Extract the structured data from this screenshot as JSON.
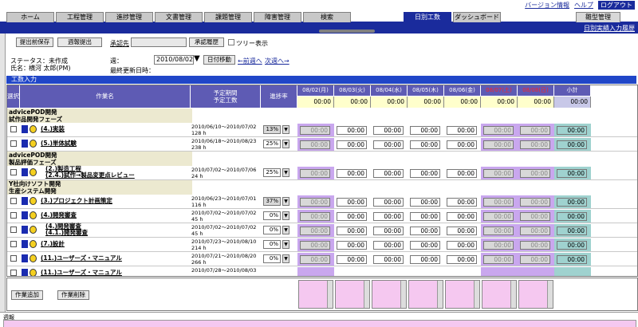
{
  "header": {
    "links": [
      "バージョン情報",
      "ヘルプ",
      "ログアウト"
    ],
    "history_link": "日別実績入力履歴"
  },
  "tabs": [
    {
      "label": "ホーム",
      "active": false
    },
    {
      "label": "工程管理",
      "active": false
    },
    {
      "label": "進捗管理",
      "active": false
    },
    {
      "label": "文書管理",
      "active": false
    },
    {
      "label": "課題管理",
      "active": false
    },
    {
      "label": "障害管理",
      "active": false
    },
    {
      "label": "検索",
      "active": false
    },
    {
      "label": "日別工数",
      "active": true
    },
    {
      "label": "ダッシュボード",
      "active": false
    },
    {
      "label": "雛型管理",
      "active": false
    }
  ],
  "toolbar": {
    "save_label": "提出前保存",
    "submit_label": "週報提出",
    "approver_label": "承認先",
    "approver_value": "",
    "approval_history_label": "承認履歴",
    "tree_label": "ツリー表示"
  },
  "status": {
    "status_label": "ステータス：未作成",
    "name_label": "氏名：",
    "name_value": "横河 太郎(PM)",
    "week_label": "週：",
    "week_value": "2010/08/02",
    "date_move_label": "日付移動",
    "prev_week": "←前週へ",
    "next_week": "次週へ→",
    "last_update_label": "最終更新日時："
  },
  "section_title": "工数入力",
  "columns": {
    "select": "選択",
    "task_name": "作業名",
    "period": "予定期間\n予定工数",
    "rate": "進捗率",
    "days": [
      "08/02(月)",
      "08/03(火)",
      "08/04(水)",
      "08/05(木)",
      "08/06(金)",
      "08/07(土)",
      "08/08(日)",
      "小計"
    ],
    "totals": [
      "00:00",
      "00:00",
      "00:00",
      "00:00",
      "00:00",
      "00:00",
      "00:00",
      "00:00"
    ]
  },
  "groups": [
    {
      "title": "advicePOD開発\n試作品開発フェーズ",
      "rows": [
        {
          "name": "(4.)実装",
          "period": "2010/06/10～2010/07/02",
          "hours": "128 h",
          "rate": "13",
          "rate_dim": true,
          "cells": [
            "00:00",
            "00:00",
            "00:00",
            "00:00",
            "00:00",
            "00:00",
            "00:00",
            "00:00"
          ]
        },
        {
          "name": "(5.)単体試験",
          "period": "2010/06/18～2010/08/23",
          "hours": "238 h",
          "rate": "25",
          "rate_dim": false,
          "cells": [
            "00:00",
            "00:00",
            "00:00",
            "00:00",
            "00:00",
            "00:00",
            "00:00",
            "00:00"
          ]
        }
      ]
    },
    {
      "title": "advicePOD開発\n製品評価フェーズ",
      "rows": [
        {
          "name": "(2.)製造工程\n(2.4.)試作→製品変更点レビュー",
          "period": "2010/07/02～2010/07/06",
          "hours": "24 h",
          "rate": "25",
          "rate_dim": false,
          "cells": [
            "00:00",
            "00:00",
            "00:00",
            "00:00",
            "00:00",
            "00:00",
            "00:00",
            "00:00"
          ]
        }
      ]
    },
    {
      "title": "Y社向けソフト開発\n生産システム開発",
      "rows": [
        {
          "name": "(3.)プロジェクト計画策定",
          "period": "2010/06/23～2010/07/01",
          "hours": "116 h",
          "rate": "37",
          "rate_dim": true,
          "cells": [
            "00:00",
            "00:00",
            "00:00",
            "00:00",
            "00:00",
            "00:00",
            "00:00",
            "00:00"
          ]
        },
        {
          "name": "(4.)開発審査",
          "period": "2010/07/02～2010/07/02",
          "hours": "45 h",
          "rate": "0",
          "rate_dim": false,
          "cells": [
            "00:00",
            "00:00",
            "00:00",
            "00:00",
            "00:00",
            "00:00",
            "00:00",
            "00:00"
          ]
        },
        {
          "name": "(4.)開発審査\n(4.1.)開発審査",
          "period": "2010/07/02～2010/07/02",
          "hours": "45 h",
          "rate": "0",
          "rate_dim": false,
          "cells": [
            "00:00",
            "00:00",
            "00:00",
            "00:00",
            "00:00",
            "00:00",
            "00:00",
            "00:00"
          ]
        },
        {
          "name": "(7.)設計",
          "period": "2010/07/23～2010/08/10",
          "hours": "214 h",
          "rate": "0",
          "rate_dim": false,
          "cells": [
            "00:00",
            "00:00",
            "00:00",
            "00:00",
            "00:00",
            "00:00",
            "00:00",
            "00:00"
          ]
        },
        {
          "name": "(11.)ユーザーズ・マニュアル",
          "period": "2010/07/21～2010/08/20",
          "hours": "266 h",
          "rate": "0",
          "rate_dim": false,
          "cells": [
            "00:00",
            "00:00",
            "00:00",
            "00:00",
            "00:00",
            "00:00",
            "00:00",
            "00:00"
          ]
        },
        {
          "name": "(11.)ユーザーズ・マニュアル",
          "period": "2010/07/28～2010/08/03",
          "hours": "",
          "rate": "",
          "rate_dim": false,
          "cells": [
            "",
            "",
            "",
            "",
            "",
            "",
            "",
            ""
          ]
        }
      ]
    }
  ],
  "bottom": {
    "add_label": "作業追加",
    "delete_label": "作業削除",
    "memo_label": "週報"
  }
}
